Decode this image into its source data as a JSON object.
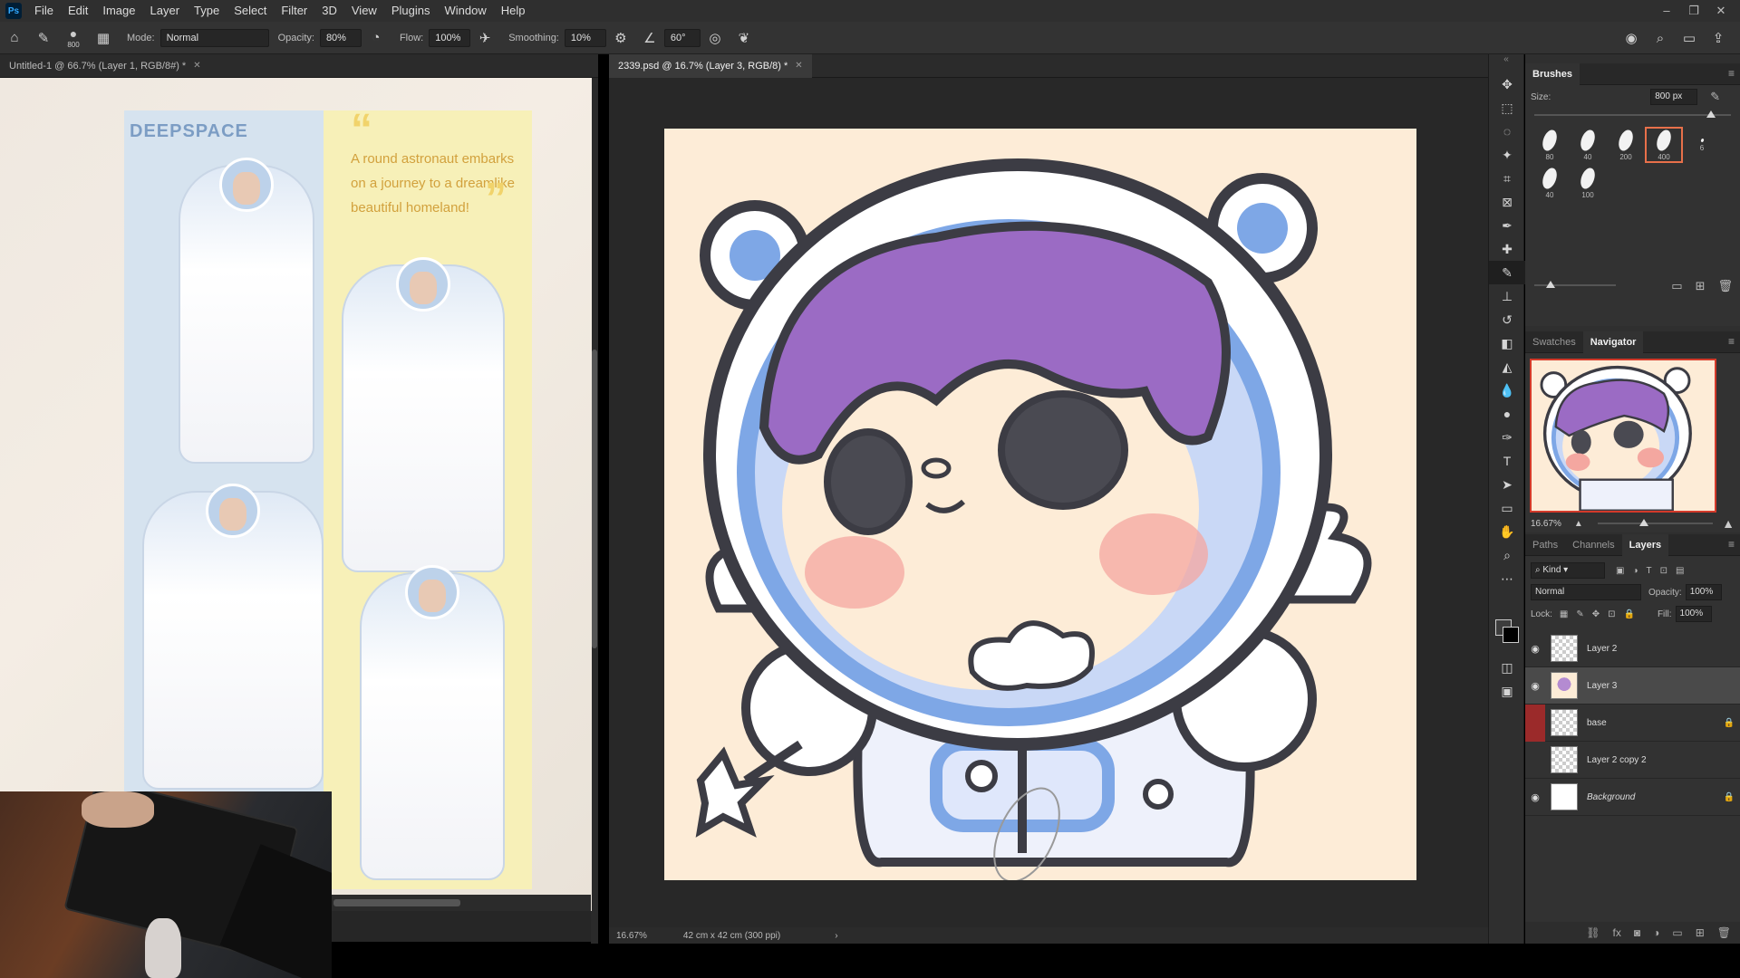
{
  "app": {
    "logo": "Ps"
  },
  "menu": [
    "File",
    "Edit",
    "Image",
    "Layer",
    "Type",
    "Select",
    "Filter",
    "3D",
    "View",
    "Plugins",
    "Window",
    "Help"
  ],
  "window_controls": {
    "minimize": "–",
    "restore": "❐",
    "close": "✕"
  },
  "options": {
    "brush_size": "800",
    "mode_label": "Mode:",
    "mode_value": "Normal",
    "opacity_label": "Opacity:",
    "opacity_value": "80%",
    "flow_label": "Flow:",
    "flow_value": "100%",
    "smoothing_label": "Smoothing:",
    "smoothing_value": "10%",
    "angle_value": "60°"
  },
  "left_doc": {
    "tab_title": "Untitled-1 @ 66.7% (Layer 1, RGB/8#) *",
    "poster_title": "DEEPSPACE",
    "poster_quote": "A round astronaut embarks on a journey to a dreamlike beautiful homeland!"
  },
  "main_doc": {
    "tab_title": "2339.psd @ 16.7% (Layer 3, RGB/8) *",
    "zoom": "16.67%",
    "doc_size": "42 cm x 42 cm (300 ppi)"
  },
  "tools": [
    "move-icon",
    "marquee-icon",
    "lasso-icon",
    "magic-wand-icon",
    "crop-icon",
    "frame-icon",
    "eyedropper-icon",
    "healing-icon",
    "brush-icon",
    "stamp-icon",
    "history-brush-icon",
    "eraser-icon",
    "bucket-icon",
    "blur-icon",
    "dodge-icon",
    "pen-icon",
    "type-icon",
    "path-select-icon",
    "rectangle-icon",
    "hand-icon",
    "zoom-icon",
    "more-icon"
  ],
  "brushes_panel": {
    "tab": "Brushes",
    "size_label": "Size:",
    "size_value": "800 px",
    "size_level": 0.9,
    "presets": [
      {
        "size": "80",
        "tiny": false,
        "selected": false
      },
      {
        "size": "40",
        "tiny": false,
        "selected": false
      },
      {
        "size": "200",
        "tiny": false,
        "selected": false
      },
      {
        "size": "400",
        "tiny": false,
        "selected": true
      },
      {
        "size": "6",
        "tiny": true,
        "selected": false
      },
      {
        "size": "40",
        "tiny": false,
        "selected": false
      },
      {
        "size": "100",
        "tiny": false,
        "selected": false
      }
    ],
    "preview_level": 0.2
  },
  "navigator_panel": {
    "tabs": [
      "Swatches",
      "Navigator"
    ],
    "active_tab": "Navigator",
    "zoom": "16.67%",
    "zoom_level": 0.4
  },
  "layers_panel": {
    "tabs": [
      "Paths",
      "Channels",
      "Layers"
    ],
    "active_tab": "Layers",
    "filter_label": "Kind",
    "blend_mode": "Normal",
    "opacity_label": "Opacity:",
    "opacity_value": "100%",
    "lock_label": "Lock:",
    "fill_label": "Fill:",
    "fill_value": "100%",
    "layers": [
      {
        "name": "Layer 2",
        "visible": true,
        "thumb": "transparent",
        "locked": false,
        "selected": false,
        "italic": false,
        "flag": ""
      },
      {
        "name": "Layer 3",
        "visible": true,
        "thumb": "char",
        "locked": false,
        "selected": true,
        "italic": false,
        "flag": ""
      },
      {
        "name": "base",
        "visible": false,
        "thumb": "transparent",
        "locked": true,
        "selected": false,
        "italic": false,
        "flag": "red"
      },
      {
        "name": "Layer 2 copy 2",
        "visible": false,
        "thumb": "transparent",
        "locked": false,
        "selected": false,
        "italic": false,
        "flag": ""
      },
      {
        "name": "Background",
        "visible": true,
        "thumb": "white",
        "locked": true,
        "selected": false,
        "italic": true,
        "flag": ""
      }
    ]
  },
  "colors": {
    "canvas_bg": "#fdecd7",
    "hair": "#9b6bc4",
    "helmet_blue": "#7ea7e6",
    "outline": "#3c3c44",
    "blush": "#f4a7a0",
    "accent_orange": "#e8704a"
  }
}
